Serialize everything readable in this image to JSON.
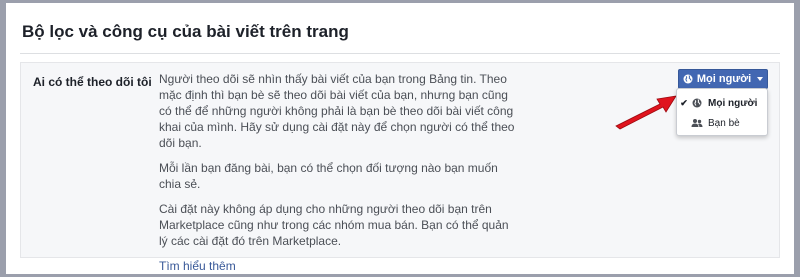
{
  "section": {
    "title": "Bộ lọc và công cụ của bài viết trên trang"
  },
  "setting": {
    "label": "Ai có thể theo dõi tôi",
    "paragraphs": [
      "Người theo dõi sẽ nhìn thấy bài viết của bạn trong Bảng tin. Theo mặc định thì bạn bè sẽ theo dõi bài viết của bạn, nhưng bạn cũng có thể để những người không phải là bạn bè theo dõi bài viết công khai của mình. Hãy sử dụng cài đặt này để chọn người có thể theo dõi bạn.",
      "Mỗi lần bạn đăng bài, bạn có thể chọn đối tượng nào bạn muốn chia sẻ.",
      "Cài đặt này không áp dụng cho những người theo dõi bạn trên Marketplace cũng như trong các nhóm mua bán. Bạn có thể quản lý các cài đặt đó trên Marketplace."
    ],
    "learn_more": "Tìm hiểu thêm"
  },
  "dropdown": {
    "selected": "Mọi người",
    "icon": "globe-icon",
    "options": [
      {
        "label": "Mọi người",
        "icon": "globe-icon",
        "checked": true
      },
      {
        "label": "Bạn bè",
        "icon": "friends-icon",
        "checked": false
      }
    ]
  },
  "colors": {
    "button_bg": "#4267b2",
    "link": "#385898",
    "annotation_arrow": "#e0141e",
    "frame": "#9b9fac"
  }
}
